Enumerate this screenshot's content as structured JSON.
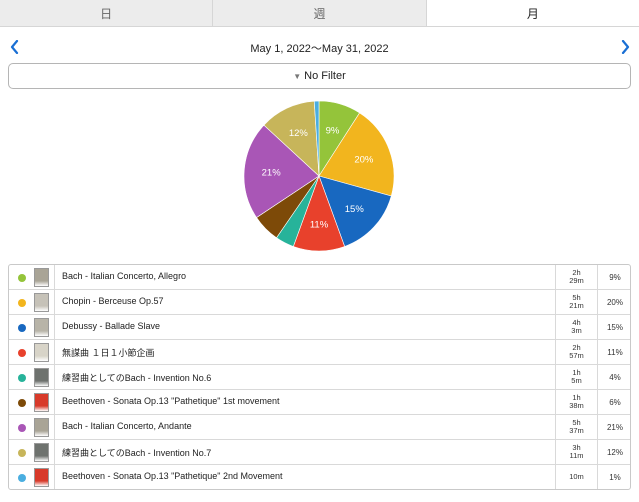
{
  "tabs": [
    {
      "label": "日",
      "active": false
    },
    {
      "label": "週",
      "active": false
    },
    {
      "label": "月",
      "active": true
    }
  ],
  "date_range": "May 1, 2022～May 31, 2022",
  "filter": {
    "label": "No Filter",
    "icon": "triangle-down-icon"
  },
  "nav_icons": {
    "prev": "chevron-left-icon",
    "next": "chevron-right-icon"
  },
  "accent_color": "#1a6fd4",
  "chart_data": {
    "type": "pie",
    "title": "",
    "slices": [
      {
        "label": "Bach - Italian Concerto, Allegro",
        "value": 9,
        "label_text": "9%",
        "color": "#94c43a"
      },
      {
        "label": "Chopin - Berceuse Op.57",
        "value": 20,
        "label_text": "20%",
        "color": "#f2b51e"
      },
      {
        "label": "Debussy - Ballade Slave",
        "value": 15,
        "label_text": "15%",
        "color": "#1868c0"
      },
      {
        "label": "無謀曲 １日１小節企画",
        "value": 11,
        "label_text": "11%",
        "color": "#e8412c"
      },
      {
        "label": "練習曲としてのBach - Invention No.6",
        "value": 4,
        "label_text": "",
        "color": "#27b39a"
      },
      {
        "label": "Beethoven - Sonata Op.13 \"Pathetique\" 1st movement",
        "value": 6,
        "label_text": "",
        "color": "#7d4a08"
      },
      {
        "label": "Bach - Italian Concerto, Andante",
        "value": 21,
        "label_text": "21%",
        "color": "#a956b6"
      },
      {
        "label": "練習曲としてのBach - Invention No.7",
        "value": 12,
        "label_text": "12%",
        "color": "#c7b55a"
      },
      {
        "label": "Beethoven - Sonata Op.13 \"Pathetique\" 2nd Movement",
        "value": 1,
        "label_text": "",
        "color": "#4aaee0"
      }
    ]
  },
  "pieces": [
    {
      "title": "Bach - Italian Concerto, Allegro",
      "time_h": "2h",
      "time_m": "29m",
      "percent": "9%",
      "color": "#94c43a",
      "thumb": "#a9a496"
    },
    {
      "title": "Chopin - Berceuse Op.57",
      "time_h": "5h",
      "time_m": "21m",
      "percent": "20%",
      "color": "#f2b51e",
      "thumb": "#c6c2b8"
    },
    {
      "title": "Debussy - Ballade Slave",
      "time_h": "4h",
      "time_m": "3m",
      "percent": "15%",
      "color": "#1868c0",
      "thumb": "#b8b4a8"
    },
    {
      "title": "無謀曲 １日１小節企画",
      "time_h": "2h",
      "time_m": "57m",
      "percent": "11%",
      "color": "#e8412c",
      "thumb": "#d8d4c8"
    },
    {
      "title": "練習曲としてのBach - Invention No.6",
      "time_h": "1h",
      "time_m": "5m",
      "percent": "4%",
      "color": "#27b39a",
      "thumb": "#6e726e"
    },
    {
      "title": "Beethoven - Sonata Op.13 \"Pathetique\" 1st movement",
      "time_h": "1h",
      "time_m": "38m",
      "percent": "6%",
      "color": "#7d4a08",
      "thumb": "#d83a2a"
    },
    {
      "title": "Bach - Italian Concerto, Andante",
      "time_h": "5h",
      "time_m": "37m",
      "percent": "21%",
      "color": "#a956b6",
      "thumb": "#a9a496"
    },
    {
      "title": "練習曲としてのBach - Invention No.7",
      "time_h": "3h",
      "time_m": "11m",
      "percent": "12%",
      "color": "#c7b55a",
      "thumb": "#6e726e"
    },
    {
      "title": "Beethoven - Sonata Op.13 \"Pathetique\" 2nd Movement",
      "time_h": "",
      "time_m": "10m",
      "percent": "1%",
      "color": "#4aaee0",
      "thumb": "#d83a2a"
    }
  ]
}
